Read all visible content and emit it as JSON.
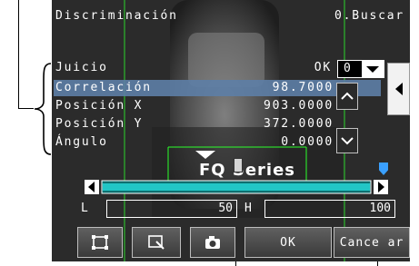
{
  "header": {
    "title": "Discriminación",
    "right_label": "0.Buscar"
  },
  "table": {
    "rows": [
      {
        "label": "Juicio",
        "value": "OK"
      },
      {
        "label": "Correlación",
        "value": "98.7000"
      },
      {
        "label": "Posición X",
        "value": "903.0000"
      },
      {
        "label": "Posición Y",
        "value": "372.0000"
      },
      {
        "label": "Ángulo",
        "value": "0.0000"
      }
    ],
    "selected_row_index": 1
  },
  "judge_select": {
    "value": "0"
  },
  "image_overlay": {
    "text": "FQ Series"
  },
  "range": {
    "low_label": "L",
    "low_value": "50",
    "high_label": "H",
    "high_value": "100",
    "fill_fraction_start": 0.0,
    "fill_fraction_end": 1.0
  },
  "toolbar": {
    "ok_label": "OK",
    "cancel_label": "Cance ar"
  },
  "colors": {
    "highlight": "#5d7ea6",
    "slider_fill": "#22c6c6",
    "marker": "#3aa0ff",
    "accent_green": "#2cff2c"
  },
  "icons": [
    "zoom-fit-icon",
    "zoom-window-icon",
    "camera-icon",
    "up-arrow-icon",
    "down-arrow-icon",
    "left-arrow-icon",
    "right-arrow-icon",
    "chevron-left-icon"
  ]
}
